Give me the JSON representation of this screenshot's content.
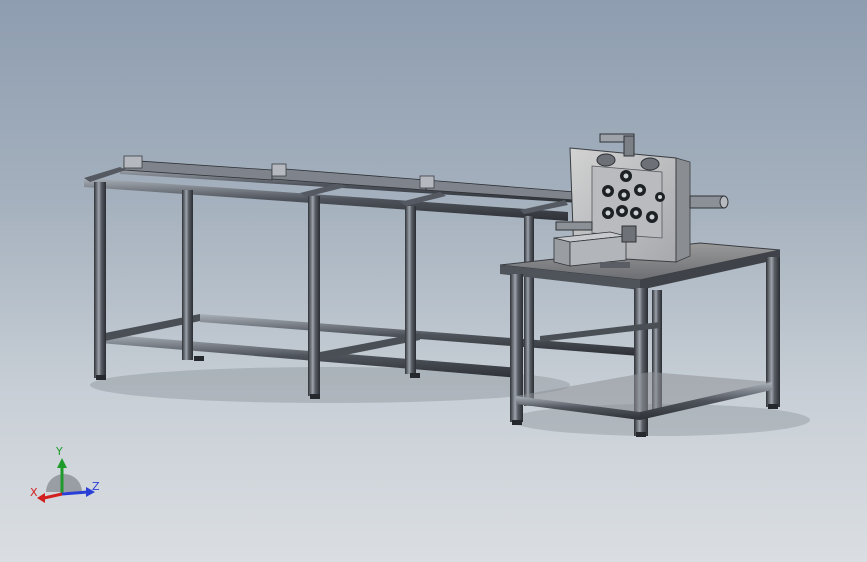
{
  "viewport": {
    "background_top": "#8e9db0",
    "background_bottom": "#dadee2"
  },
  "model": {
    "frame_color": "#4c5058",
    "frame_highlight": "#9aa1ab",
    "panel_color": "#c9c9c9",
    "accent_color": "#2f3236"
  },
  "triad": {
    "x_label": "X",
    "y_label": "Y",
    "z_label": "Z",
    "x_color": "#d21f1f",
    "y_color": "#1f9b2b",
    "z_color": "#2a3fd6"
  }
}
